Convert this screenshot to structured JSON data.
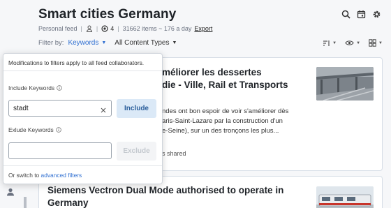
{
  "header": {
    "title": "Smart cities Germany",
    "feed_type": "Personal feed",
    "collaborator_count": "4",
    "stats": "31662 items ~ 176 a day",
    "export_label": "Export"
  },
  "header_icons": [
    "search-icon",
    "calendar-icon",
    "gear-icon"
  ],
  "filter_bar": {
    "prefix": "Filter by:",
    "keywords_label": "Keywords",
    "content_types_label": "All Content Types"
  },
  "view_icons": [
    "sort-icon",
    "eye-icon",
    "grid-layout-icon"
  ],
  "articles": [
    {
      "title_visible": "méliorer les dessertes\ndie - Ville, Rail et Transports",
      "summary_visible": "ndes ont bon espoir de voir s'améliorer dès\naris-Saint-Lazare par la construction d'un\ne-Seine), sur un des tronçons les plus...",
      "shared_visible": "s shared"
    },
    {
      "title": "Siemens Vectron Dual Mode authorised to operate in Germany"
    }
  ],
  "keyword_popover": {
    "note": "Modifications to filters apply to all feed collaborators.",
    "include_label": "Include Keywords",
    "include_value": "stadt",
    "include_button": "Include",
    "exclude_label": "Exlude Keywords",
    "exclude_value": "",
    "exclude_button": "Exclude",
    "footer_prefix": "Or switch to",
    "footer_link": "advanced filters"
  },
  "colors": {
    "accent": "#2f6fd1",
    "include_button_bg": "#dbe9f7",
    "page_bg": "#f6f7f9"
  }
}
